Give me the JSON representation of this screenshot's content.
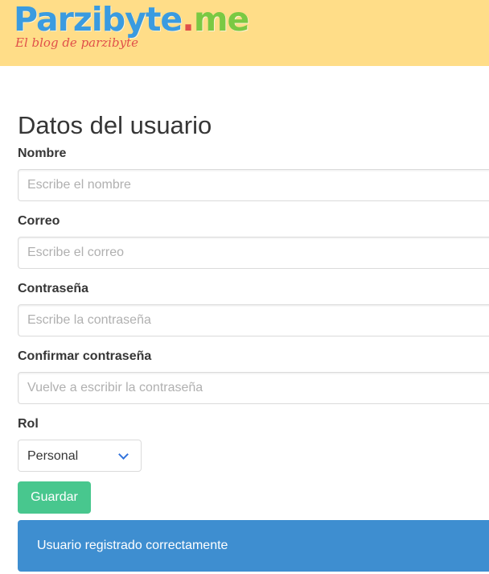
{
  "header": {
    "brand_name": "Parzibyte",
    "brand_dot": ".",
    "brand_tld": "me",
    "tagline": "El blog de parzibyte",
    "bg_color": "#ffdd88"
  },
  "form": {
    "title": "Datos del usuario",
    "fields": [
      {
        "label": "Nombre",
        "placeholder": "Escribe el nombre",
        "value": ""
      },
      {
        "label": "Correo",
        "placeholder": "Escribe el correo",
        "value": ""
      },
      {
        "label": "Contraseña",
        "placeholder": "Escribe la contraseña",
        "value": ""
      },
      {
        "label": "Confirmar contraseña",
        "placeholder": "Vuelve a escribir la contraseña",
        "value": ""
      }
    ],
    "role": {
      "label": "Rol",
      "selected": "Personal"
    },
    "save_label": "Guardar",
    "save_color": "#48c78e"
  },
  "notification": {
    "message": "Usuario registrado correctamente",
    "color": "#3e8ed0"
  }
}
